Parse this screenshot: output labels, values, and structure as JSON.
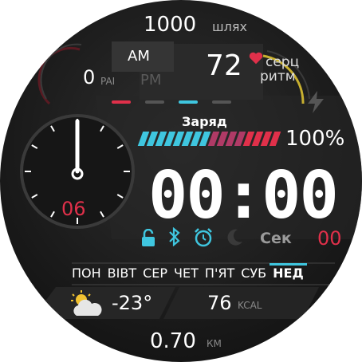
{
  "steps": {
    "value": "1000",
    "unit": "шлях"
  },
  "pai": {
    "value": "0",
    "unit": "PAI"
  },
  "ampm": {
    "am": "AM",
    "pm": "PM"
  },
  "heart": {
    "value": "72",
    "label_line1": "серц",
    "label_line2": "ритм"
  },
  "battery": {
    "label": "Заряд",
    "percent_text": "100%",
    "level": 1.0
  },
  "time": {
    "display": "00:00",
    "seconds_label": "Сек",
    "seconds_value": "00"
  },
  "subdial": {
    "value": "06"
  },
  "weekdays": [
    {
      "label": "ПОН",
      "active": false
    },
    {
      "label": "ВІВТ",
      "active": false
    },
    {
      "label": "СЕР",
      "active": false
    },
    {
      "label": "ЧЕТ",
      "active": false
    },
    {
      "label": "П'ЯТ",
      "active": false
    },
    {
      "label": "СУБ",
      "active": false
    },
    {
      "label": "НЕД",
      "active": true
    }
  ],
  "weather": {
    "temperature": "-23°",
    "icon": "partly-cloudy-icon"
  },
  "calories": {
    "value": "76",
    "unit": "KCAL"
  },
  "distance": {
    "value": "0.70",
    "unit": "КМ"
  },
  "status_icons": [
    "lock-icon",
    "bluetooth-icon",
    "alarm-icon",
    "moon-icon"
  ],
  "colors": {
    "accent_cyan": "#3fc6df",
    "accent_red": "#e0304a",
    "background": "#1c1c1c"
  }
}
